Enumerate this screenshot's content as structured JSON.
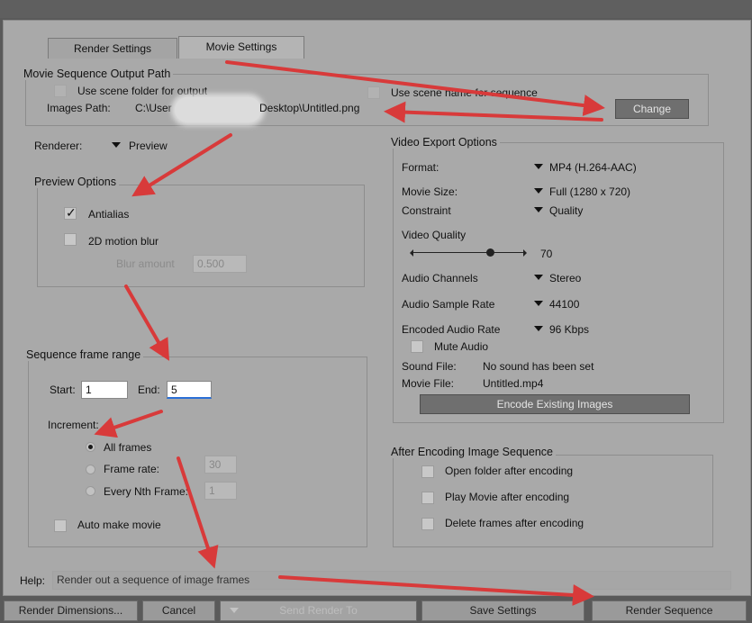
{
  "tabs": [
    {
      "label": "Render Settings",
      "active": false
    },
    {
      "label": "Movie Settings",
      "active": true
    }
  ],
  "output_path": {
    "title": "Movie Sequence Output Path",
    "use_scene_folder": {
      "label": "Use scene folder for output",
      "checked": false
    },
    "use_scene_name": {
      "label": "Use scene name for sequence",
      "checked": false
    },
    "images_path_label": "Images Path:",
    "images_path_prefix": "C:\\User",
    "images_path_suffix": "Desktop\\Untitled.png",
    "change_button": "Change"
  },
  "renderer": {
    "label": "Renderer:",
    "value": "Preview"
  },
  "preview_options": {
    "title": "Preview Options",
    "antialias": {
      "label": "Antialias",
      "checked": true
    },
    "motion_blur": {
      "label": "2D motion blur",
      "checked": false
    },
    "blur_amount_label": "Blur amount",
    "blur_amount_value": "0.500"
  },
  "frame_range": {
    "title": "Sequence frame range",
    "start_label": "Start:",
    "start_value": "1",
    "end_label": "End:",
    "end_value": "5",
    "increment_label": "Increment:",
    "options": [
      {
        "label": "All frames",
        "selected": true,
        "value": ""
      },
      {
        "label": "Frame rate:",
        "selected": false,
        "value": "30"
      },
      {
        "label": "Every Nth Frame:",
        "selected": false,
        "value": "1"
      }
    ],
    "auto_make_movie": {
      "label": "Auto make movie",
      "checked": false
    }
  },
  "video_export": {
    "title": "Video Export Options",
    "format": {
      "label": "Format:",
      "value": "MP4 (H.264-AAC)"
    },
    "movie_size": {
      "label": "Movie Size:",
      "value": "Full (1280 x 720)"
    },
    "constraint": {
      "label": "Constraint",
      "value": "Quality"
    },
    "video_quality": {
      "label": "Video Quality",
      "value": "70",
      "level": 0.7
    },
    "audio_channels": {
      "label": "Audio Channels",
      "value": "Stereo"
    },
    "audio_sample_rate": {
      "label": "Audio Sample Rate",
      "value": "44100"
    },
    "encoded_audio_rate": {
      "label": "Encoded Audio Rate",
      "value": "96 Kbps"
    },
    "mute_audio": {
      "label": "Mute Audio",
      "checked": false
    },
    "sound_file": {
      "label": "Sound File:",
      "value": "No sound has been set"
    },
    "movie_file": {
      "label": "Movie File:",
      "value": "Untitled.mp4"
    },
    "encode_button": "Encode Existing Images"
  },
  "after_encoding": {
    "title": "After Encoding Image Sequence",
    "options": [
      {
        "label": "Open folder after encoding",
        "checked": false
      },
      {
        "label": "Play Movie after encoding",
        "checked": false
      },
      {
        "label": "Delete frames after encoding",
        "checked": false
      }
    ]
  },
  "help": {
    "label": "Help:",
    "text": "Render out a sequence of image frames"
  },
  "footer": {
    "render_dimensions": "Render Dimensions...",
    "cancel": "Cancel",
    "send_render_to": "Send Render To",
    "save_settings": "Save Settings",
    "render_sequence": "Render Sequence"
  },
  "colors": {
    "annotation_arrow": "#d83a3a",
    "focus_underline": "#2a6fd6"
  }
}
